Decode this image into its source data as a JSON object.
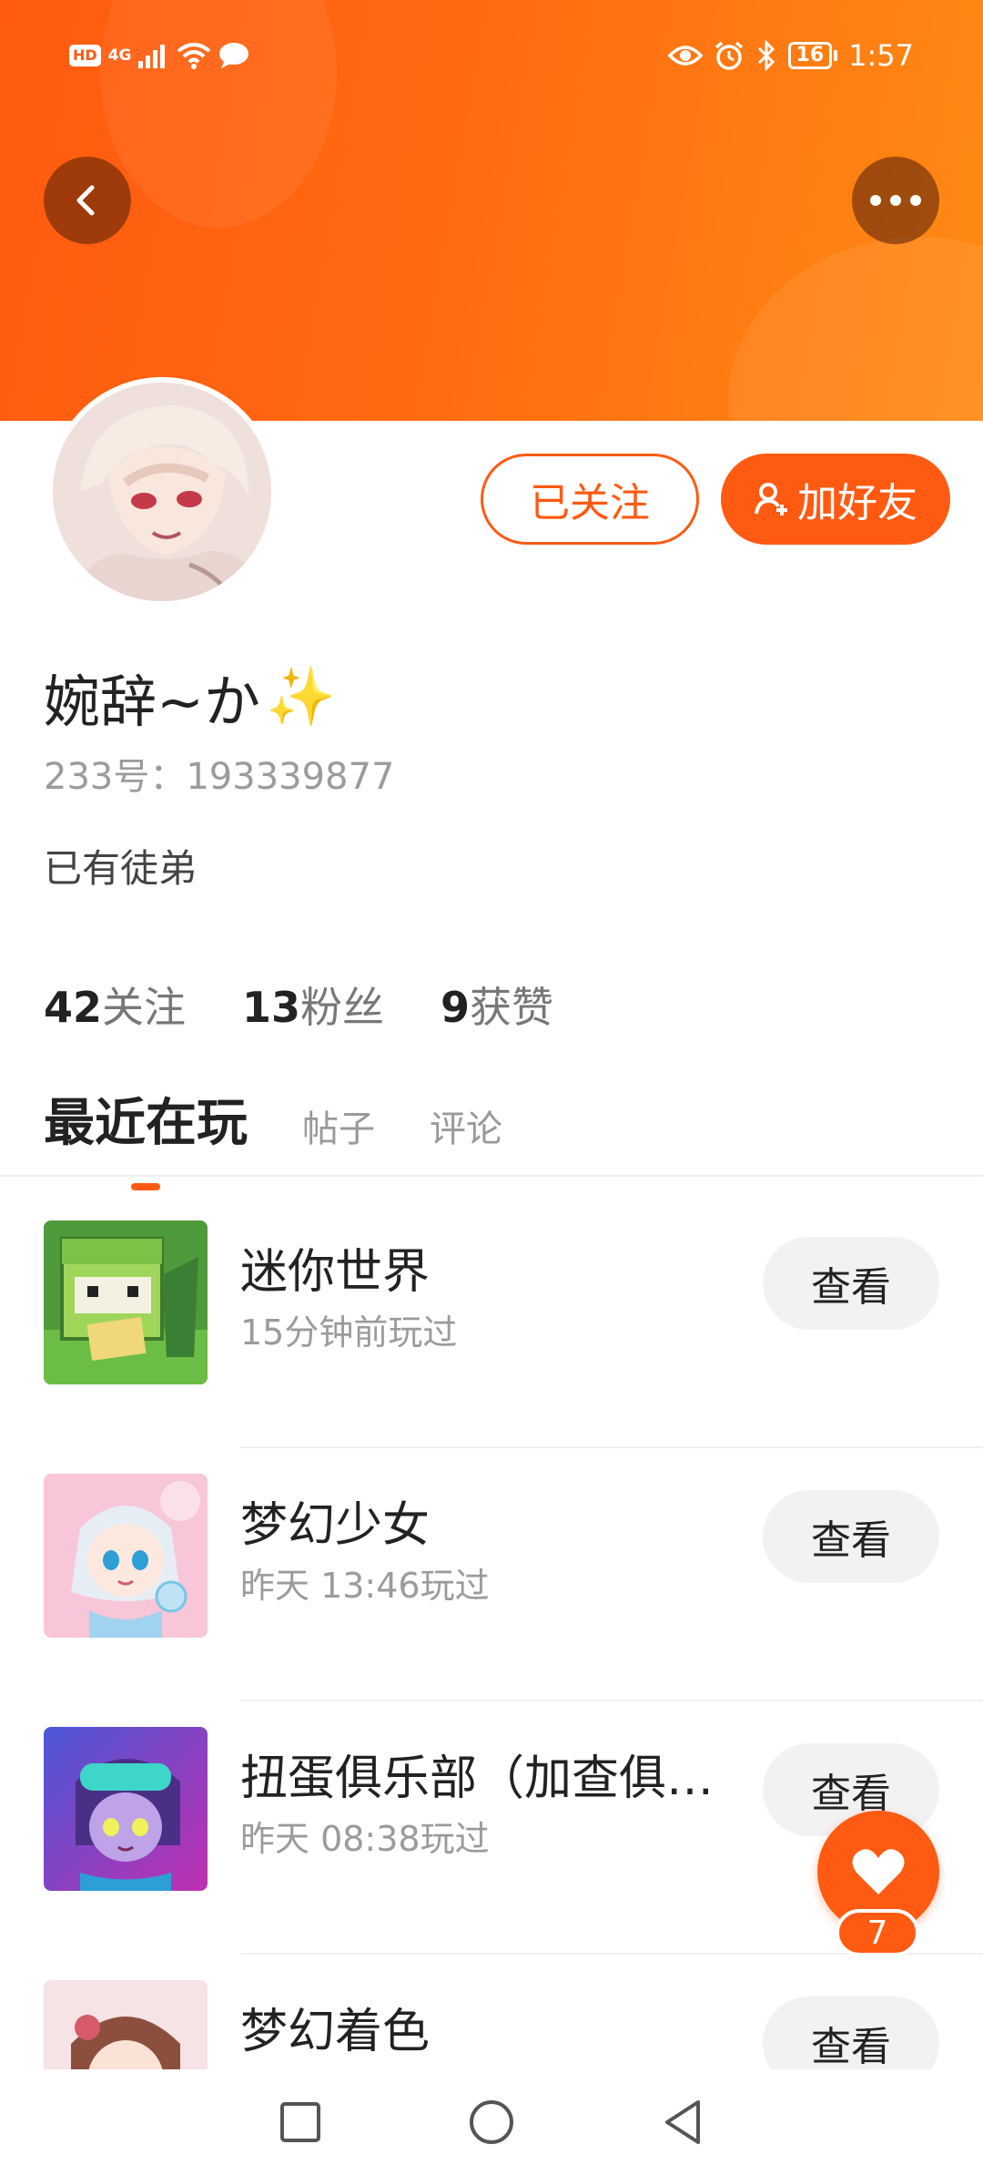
{
  "status_bar": {
    "hd": "HD",
    "network": "4G",
    "battery": "16",
    "time": "1:57"
  },
  "header": {
    "back_icon": "chevron-left-icon",
    "more_icon": "more-dots-icon",
    "banner_color": "#ff6a10"
  },
  "profile": {
    "name": "婉辞~か",
    "name_emoji": "✨",
    "id_label": "233号：193339877",
    "bio": "已有徒弟",
    "followed_label": "已关注",
    "add_friend_label": "加好友",
    "stats": [
      {
        "num": "42",
        "label": "关注"
      },
      {
        "num": "13",
        "label": "粉丝"
      },
      {
        "num": "9",
        "label": "获赞"
      }
    ]
  },
  "tabs": [
    "最近在玩",
    "帖子",
    "评论"
  ],
  "games": [
    {
      "name": "迷你世界",
      "time": "15分钟前玩过",
      "action": "查看"
    },
    {
      "name": "梦幻少女",
      "time": "昨天 13:46玩过",
      "action": "查看"
    },
    {
      "name": "扭蛋俱乐部（加查俱乐部）",
      "time": "昨天 08:38玩过",
      "action": "查看"
    },
    {
      "name": "梦幻着色",
      "time": "",
      "action": "查看"
    }
  ],
  "like_fab": {
    "count": "7"
  },
  "colors": {
    "accent": "#ff5a12"
  }
}
